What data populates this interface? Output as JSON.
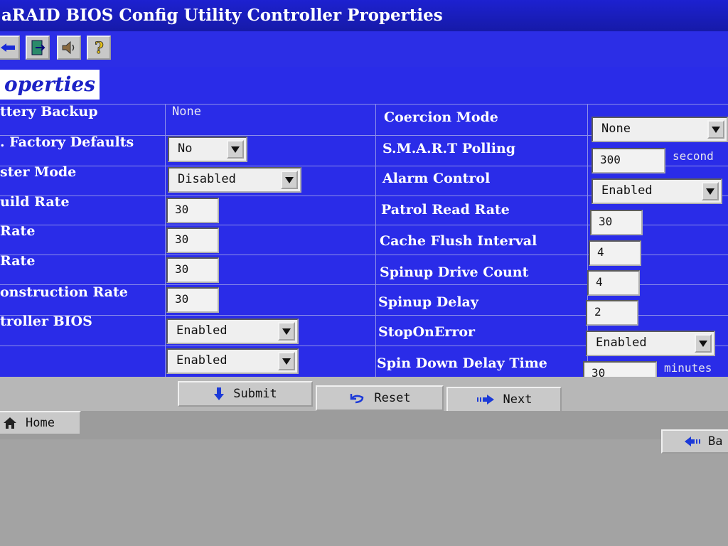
{
  "window": {
    "title": "aRAID BIOS Config Utility  Controller Properties"
  },
  "toolbar": {
    "icons": [
      "back-arrow-icon",
      "exit-door-icon",
      "speaker-icon",
      "help-question-icon"
    ]
  },
  "page": {
    "section_title": "operties"
  },
  "left": {
    "rows": [
      {
        "label": "ttery Backup",
        "value": "None"
      },
      {
        "label": ". Factory Defaults",
        "value": "No"
      },
      {
        "label": "ster Mode",
        "value": "Disabled"
      },
      {
        "label": "uild Rate",
        "value": "30"
      },
      {
        "label": "Rate",
        "value": "30"
      },
      {
        "label": "Rate",
        "value": "30"
      },
      {
        "label": "onstruction Rate",
        "value": "30"
      },
      {
        "label": "troller BIOS",
        "value": "Enabled"
      },
      {
        "label": "",
        "value": "Enabled"
      }
    ]
  },
  "right": {
    "rows": [
      {
        "label": "Coercion Mode",
        "value": "None",
        "unit": ""
      },
      {
        "label": "S.M.A.R.T Polling",
        "value": "300",
        "unit": "second"
      },
      {
        "label": "Alarm Control",
        "value": "Enabled",
        "unit": ""
      },
      {
        "label": "Patrol Read Rate",
        "value": "30",
        "unit": ""
      },
      {
        "label": "Cache Flush Interval",
        "value": "4",
        "unit": ""
      },
      {
        "label": "Spinup Drive Count",
        "value": "4",
        "unit": ""
      },
      {
        "label": "Spinup Delay",
        "value": "2",
        "unit": ""
      },
      {
        "label": "StopOnError",
        "value": "Enabled",
        "unit": ""
      },
      {
        "label": "Spin Down Delay Time",
        "value": "30",
        "unit": "minutes"
      }
    ]
  },
  "actions": {
    "submit": "Submit",
    "reset": "Reset",
    "next": "Next"
  },
  "nav": {
    "home": "Home",
    "back": "Ba"
  },
  "colors": {
    "title_bar": "#1d21d0",
    "panel": "#2a2ce8",
    "field": "#f2f2f2",
    "button": "#c9c9c9"
  }
}
